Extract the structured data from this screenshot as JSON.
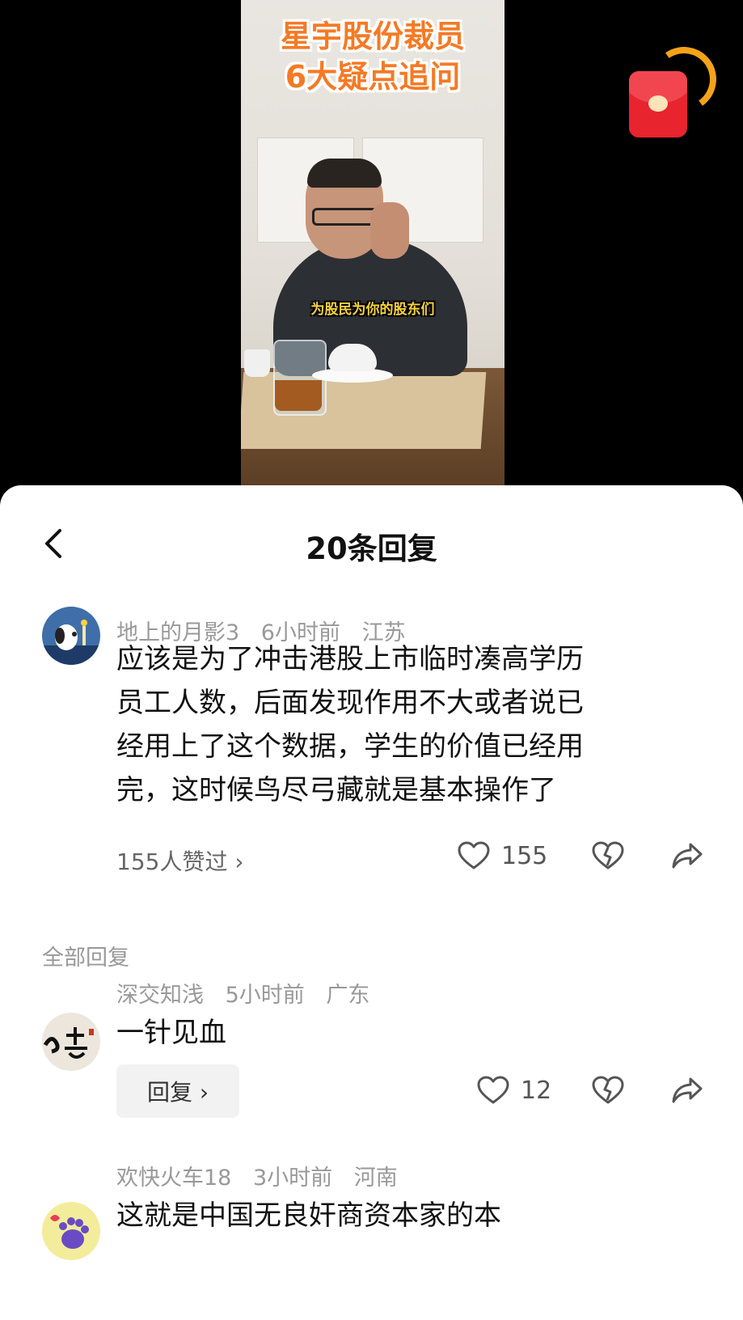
{
  "video": {
    "title_lines": [
      "星宇股份裁员",
      "6大疑点追问"
    ],
    "subtitle": "为股民为你的股东们"
  },
  "sheet": {
    "title": "20条回复",
    "main_comment": {
      "username": "地上的月影3",
      "time": "6小时前",
      "location": "江苏",
      "lines": [
        "应该是为了冲击港股上市临时凑高学历",
        "员工人数，后面发现作用不大或者说已",
        "经用上了这个数据，学生的价值已经用",
        "完，这时候鸟尽弓藏就是基本操作了"
      ],
      "likers_text": "155人赞过 ›",
      "like_count": "155"
    },
    "section_label": "全部回复",
    "replies": [
      {
        "username": "深交知浅",
        "time": "5小时前",
        "location": "广东",
        "text": "一针见血",
        "reply_label": "回复 ›",
        "like_count": "12"
      },
      {
        "username": "欢快火车18",
        "time": "3小时前",
        "location": "河南",
        "text": "这就是中国无良奸商资本家的本"
      }
    ]
  },
  "icons": [
    "back-icon",
    "heart-icon",
    "broken-heart-icon",
    "share-icon",
    "red-packet-icon"
  ],
  "colors": {
    "accent_orange": "#f47a25",
    "red_packet": "#e8242e",
    "meta_gray": "#999999"
  }
}
